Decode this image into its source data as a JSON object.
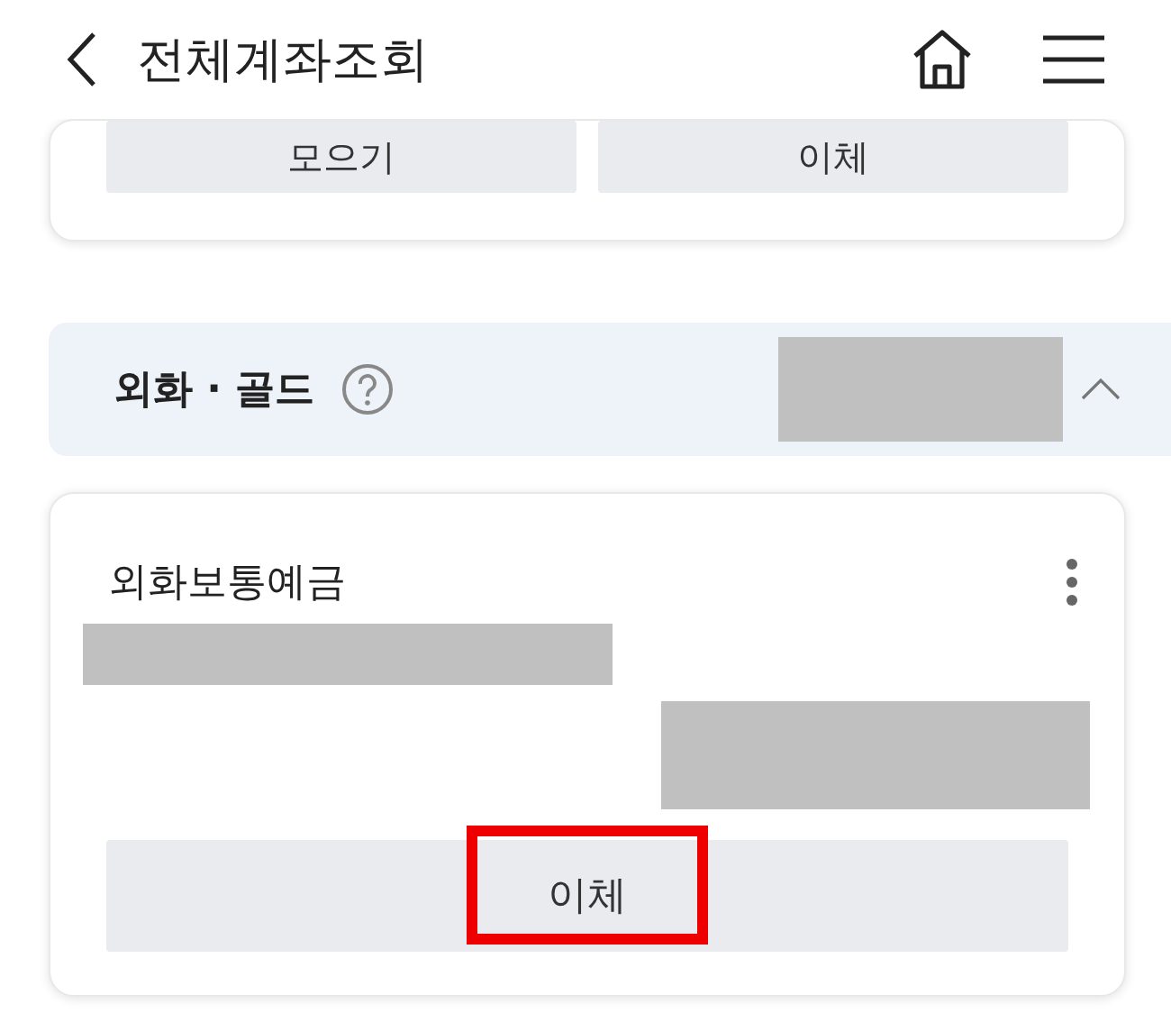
{
  "header": {
    "title": "전체계좌조회"
  },
  "previous_card": {
    "buttons": [
      {
        "label": "모으기"
      },
      {
        "label": "이체"
      }
    ]
  },
  "section": {
    "title": "외화 · 골드",
    "expanded": true,
    "amount_redacted": true
  },
  "account": {
    "name": "외화보통예금",
    "number_redacted": true,
    "balance_redacted": true,
    "buttons": [
      {
        "label": "이체",
        "highlighted": true
      }
    ]
  }
}
